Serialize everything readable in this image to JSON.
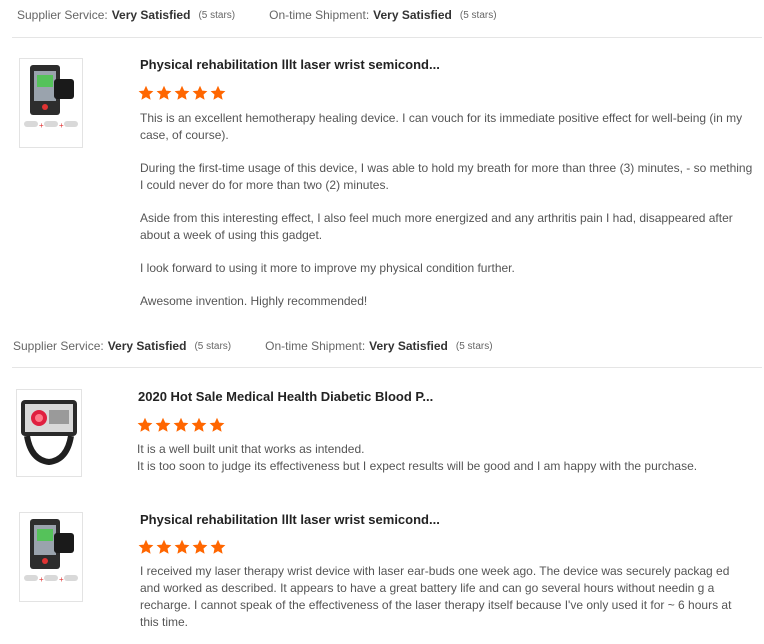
{
  "colors": {
    "star": "#ff6600",
    "title": "#222222",
    "text": "#555555",
    "divider": "#e5e5e5"
  },
  "ratings_block_1": {
    "supplier_label": "Supplier Service:",
    "supplier_value": "Very Satisfied",
    "supplier_stars": "(5 stars)",
    "shipment_label": "On-time Shipment:",
    "shipment_value": "Very Satisfied",
    "shipment_stars": "(5 stars)"
  },
  "reviews": [
    {
      "product_title": "Physical rehabilitation lllt laser wrist semicond...",
      "rating": 5,
      "thumb_icon": "laser-wrist-device-thumbnail",
      "paragraphs": [
        "This is an excellent hemotherapy healing device. I can vouch for its immediate positive effect for well-being (in my case, of course).",
        "During the first-time usage of this device, I was able to hold my breath for more than three (3) minutes, - so mething I could never do for more than two (2) minutes.",
        "Aside from this interesting effect, I also feel much more energized and any arthritis pain I had, disappeared after about a week of using this gadget.",
        "I look forward to using it more to improve my physical condition further.",
        "Awesome invention. Highly recommended!"
      ]
    },
    {
      "product_title": "2020 Hot Sale Medical Health Diabetic Blood P...",
      "rating": 5,
      "thumb_icon": "red-laser-wrist-watch-thumbnail",
      "paragraphs": [
        "It is a well built unit that works as intended.",
        "It is too soon to judge its effectiveness but I expect results will be good and I am happy with the purchase."
      ]
    },
    {
      "product_title": "Physical rehabilitation lllt laser wrist semicond...",
      "rating": 5,
      "thumb_icon": "laser-wrist-device-thumbnail",
      "paragraphs": [
        "I received my laser therapy wrist device with laser ear-buds one week ago. The device was securely packag ed and worked as described. It appears to have a great battery life and can go several hours without needin g a recharge.  I cannot speak of the effectiveness of the laser therapy itself because I've only used it for ~ 6 hours at this time."
      ]
    }
  ],
  "ratings_block_2": {
    "supplier_label": "Supplier Service:",
    "supplier_value": "Very Satisfied",
    "supplier_stars": "(5 stars)",
    "shipment_label": "On-time Shipment:",
    "shipment_value": "Very Satisfied",
    "shipment_stars": "(5 stars)"
  }
}
